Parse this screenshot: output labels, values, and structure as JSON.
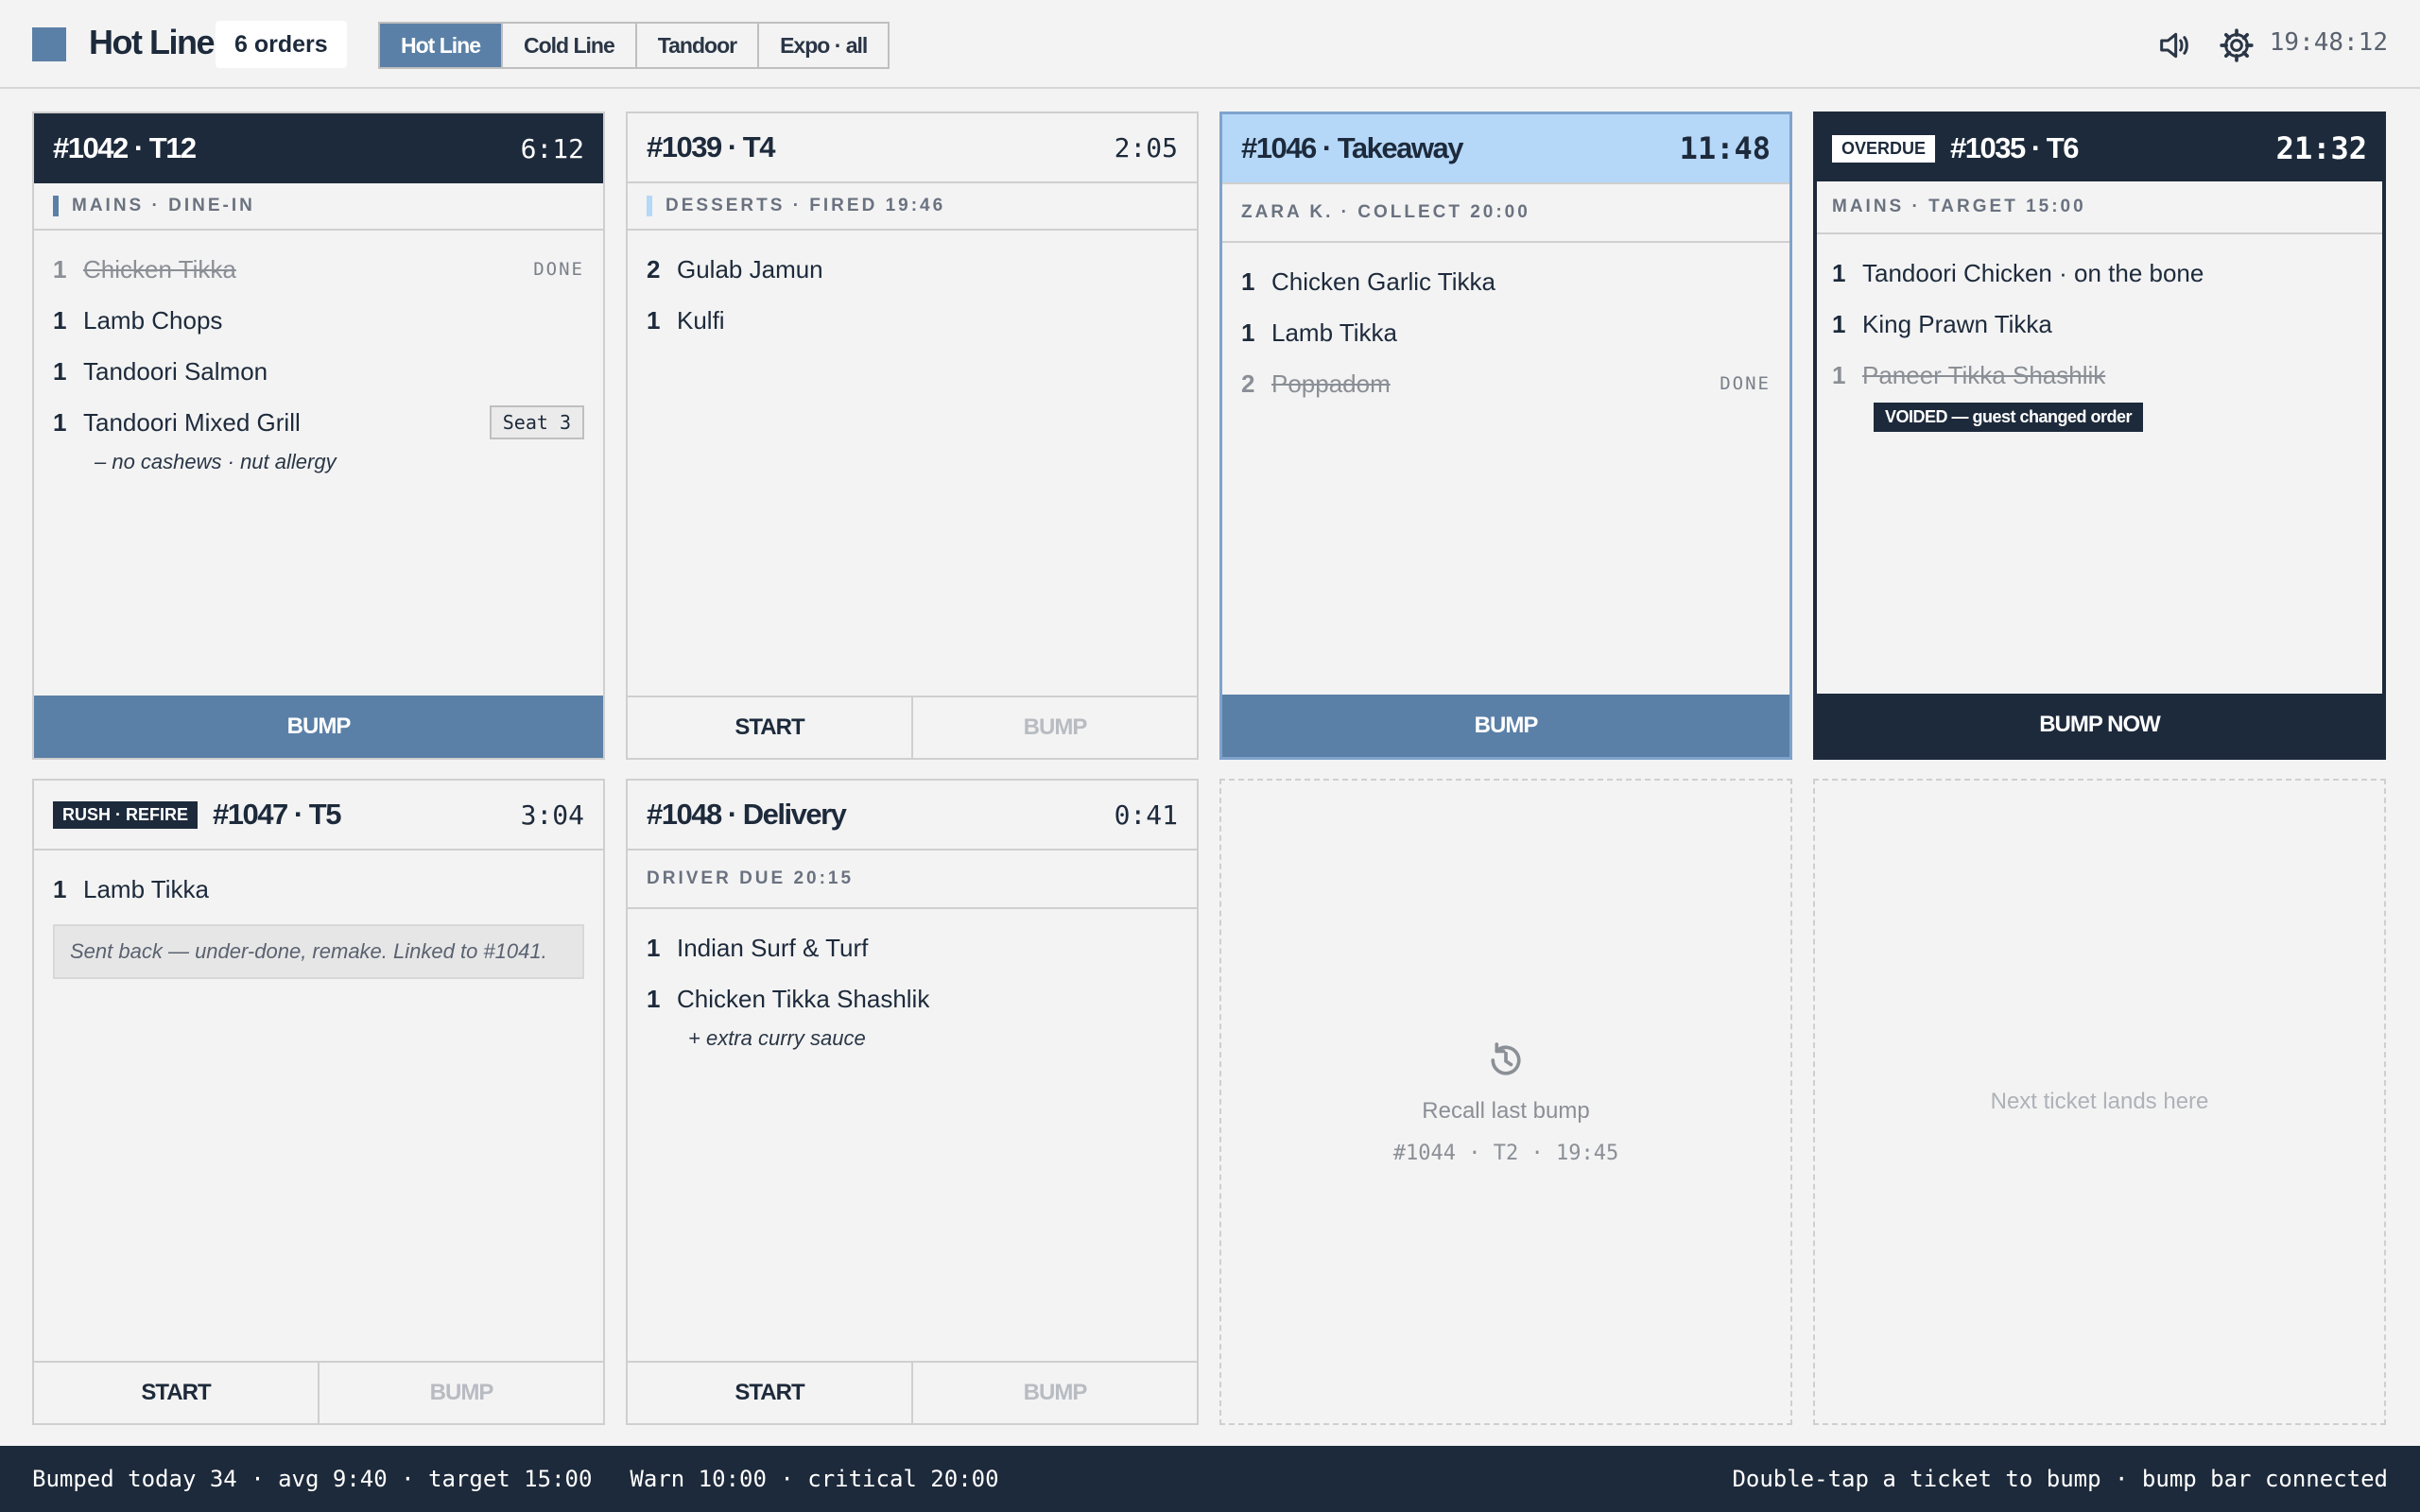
{
  "header": {
    "title": "Hot Line",
    "order_count": "6 orders",
    "tabs": [
      "Hot Line",
      "Cold Line",
      "Tandoor",
      "Expo · all"
    ],
    "active_tab": "Hot Line",
    "clock": "19:48:12",
    "icons": {
      "sound": "speaker-icon",
      "settings": "gear-icon"
    }
  },
  "tickets": {
    "t1042": {
      "id": "#1042 · T12",
      "timer": "6:12",
      "sub": "MAINS · DINE-IN",
      "items": [
        {
          "qty": "1",
          "name": "Chicken Tikka",
          "tag": "DONE"
        },
        {
          "qty": "1",
          "name": "Lamb Chops"
        },
        {
          "qty": "1",
          "name": "Tandoori Salmon"
        },
        {
          "qty": "1",
          "name": "Tandoori Mixed Grill",
          "badge": "Seat 3"
        }
      ],
      "modifier": "– no cashews · nut allergy",
      "bump_label": "BUMP"
    },
    "t1039": {
      "id": "#1039 · T4",
      "timer": "2:05",
      "sub": "DESSERTS · FIRED 19:46",
      "items": [
        {
          "qty": "2",
          "name": "Gulab Jamun"
        },
        {
          "qty": "1",
          "name": "Kulfi"
        }
      ],
      "start_label": "START",
      "bump_label": "BUMP"
    },
    "t1046": {
      "id": "#1046 · Takeaway",
      "timer": "11:48",
      "sub": "ZARA K. · COLLECT 20:00",
      "items": [
        {
          "qty": "1",
          "name": "Chicken Garlic Tikka"
        },
        {
          "qty": "1",
          "name": "Lamb Tikka"
        },
        {
          "qty": "2",
          "name": "Poppadom",
          "tag": "DONE"
        }
      ],
      "bump_label": "BUMP"
    },
    "t1035": {
      "id": "#1035 · T6",
      "timer": "21:32",
      "status": "OVERDUE",
      "sub": "MAINS · TARGET 15:00",
      "items": [
        {
          "qty": "1",
          "name": "Tandoori Chicken · on the bone"
        },
        {
          "qty": "1",
          "name": "King Prawn Tikka"
        },
        {
          "qty": "1",
          "name": "Paneer Tikka Shashlik"
        }
      ],
      "void_label": "VOIDED — guest changed order",
      "bump_label": "BUMP NOW"
    },
    "t1047": {
      "id": "#1047 · T5",
      "timer": "3:04",
      "status": "RUSH · REFIRE",
      "items": [
        {
          "qty": "1",
          "name": "Lamb Tikka"
        }
      ],
      "note": "Sent back — under-done, remake. Linked to #1041.",
      "start_label": "START",
      "bump_label": "BUMP"
    },
    "t1048": {
      "id": "#1048 · Delivery",
      "timer": "0:41",
      "sub": "DRIVER DUE 20:15",
      "items": [
        {
          "qty": "1",
          "name": "Indian Surf & Turf"
        },
        {
          "qty": "1",
          "name": "Chicken Tikka Shashlik"
        }
      ],
      "modifier": "+ extra curry sauce",
      "start_label": "START",
      "bump_label": "BUMP"
    }
  },
  "recall": {
    "label": "Recall last bump",
    "detail": "#1044 · T2 · 19:45",
    "icon": "history-icon"
  },
  "empty_slot": {
    "label": "Next ticket lands here"
  },
  "statusbar": {
    "bumped": "Bumped today 34 · avg 9:40 · target 15:00",
    "thresholds": "Warn 10:00 · critical 20:00",
    "hint": "Double-tap a ticket to bump · bump bar connected"
  },
  "colors": {
    "accent": "#5b80a7",
    "dark": "#1d2a3b",
    "highlight": "#b5d7f8"
  }
}
